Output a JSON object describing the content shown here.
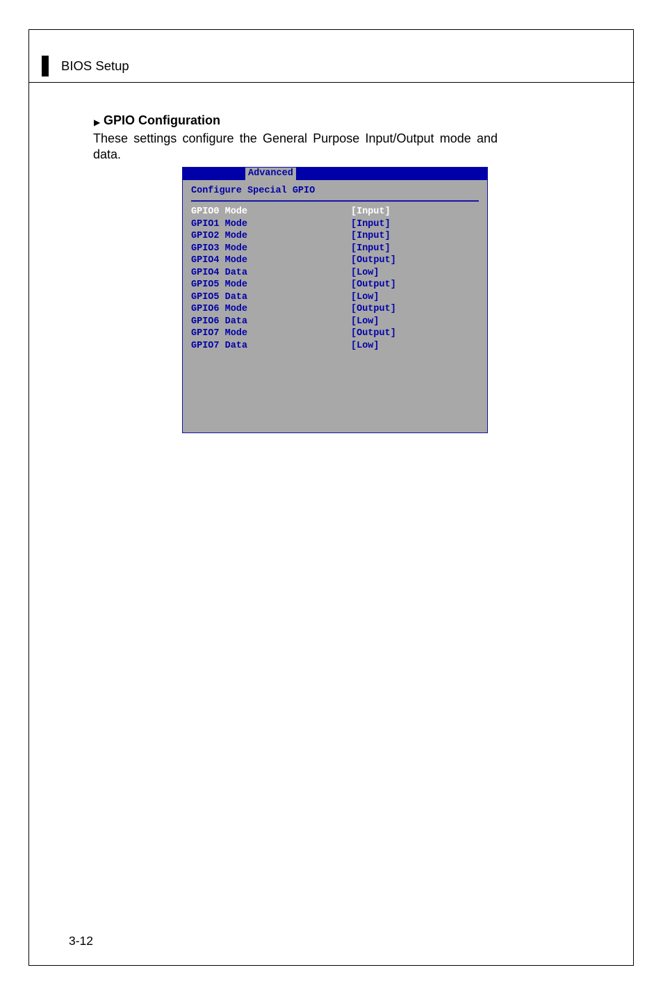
{
  "header": {
    "title": "BIOS Setup"
  },
  "section": {
    "heading": "GPIO Configuration",
    "body": "These settings configure the General Purpose Input/Output mode and data."
  },
  "bios": {
    "tab": "Advanced",
    "subtitle": "Configure Special GPIO",
    "rows": [
      {
        "label": "GPIO0 Mode",
        "value": "[Input]",
        "selected": true
      },
      {
        "label": "GPIO1 Mode",
        "value": "[Input]",
        "selected": false
      },
      {
        "label": "GPIO2 Mode",
        "value": "[Input]",
        "selected": false
      },
      {
        "label": "GPIO3 Mode",
        "value": "[Input]",
        "selected": false
      },
      {
        "label": "GPIO4 Mode",
        "value": "[Output]",
        "selected": false
      },
      {
        "label": "GPIO4 Data",
        "value": "[Low]",
        "selected": false
      },
      {
        "label": "GPIO5 Mode",
        "value": "[Output]",
        "selected": false
      },
      {
        "label": "GPIO5 Data",
        "value": "[Low]",
        "selected": false
      },
      {
        "label": "GPIO6 Mode",
        "value": "[Output]",
        "selected": false
      },
      {
        "label": "GPIO6 Data",
        "value": "[Low]",
        "selected": false
      },
      {
        "label": "GPIO7 Mode",
        "value": "[Output]",
        "selected": false
      },
      {
        "label": "GPIO7 Data",
        "value": "[Low]",
        "selected": false
      }
    ]
  },
  "page": {
    "number": "3-12"
  }
}
